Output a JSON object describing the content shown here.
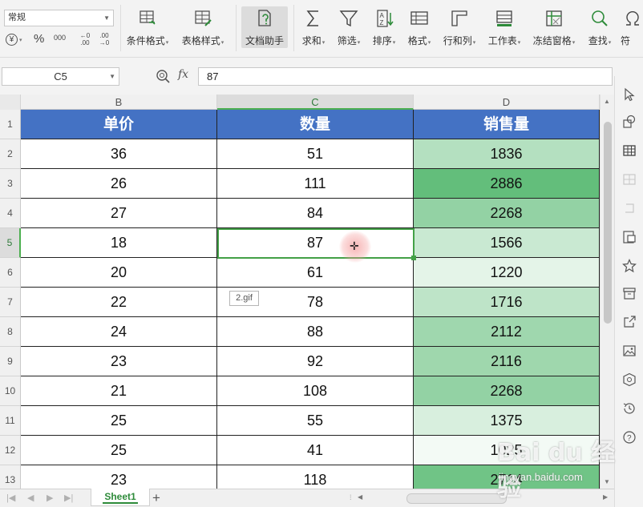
{
  "ribbon": {
    "number_format_select": "常规",
    "number_format_buttons": [
      "¥",
      "%",
      "000",
      "←0 .00",
      ".00 →0"
    ],
    "buttons": [
      {
        "id": "conditional-format",
        "label": "条件格式",
        "dropdown": true
      },
      {
        "id": "table-style",
        "label": "表格样式",
        "dropdown": true
      },
      {
        "id": "doc-assistant",
        "label": "文档助手",
        "dropdown": false,
        "active": true
      },
      {
        "id": "sum",
        "label": "求和",
        "dropdown": true
      },
      {
        "id": "filter",
        "label": "筛选",
        "dropdown": true
      },
      {
        "id": "sort",
        "label": "排序",
        "dropdown": true
      },
      {
        "id": "format",
        "label": "格式",
        "dropdown": true
      },
      {
        "id": "row-col",
        "label": "行和列",
        "dropdown": true
      },
      {
        "id": "worksheet",
        "label": "工作表",
        "dropdown": true
      },
      {
        "id": "freeze-panes",
        "label": "冻结窗格",
        "dropdown": true
      },
      {
        "id": "find",
        "label": "查找",
        "dropdown": true
      },
      {
        "id": "symbol",
        "label": "符",
        "dropdown": false
      }
    ]
  },
  "formula_bar": {
    "name_box": "C5",
    "fx_label": "fx",
    "formula_value": "87"
  },
  "grid": {
    "columns": [
      "B",
      "C",
      "D"
    ],
    "selected_column": "C",
    "row_numbers": [
      "1",
      "2",
      "3",
      "4",
      "5",
      "6",
      "7",
      "8",
      "9",
      "10",
      "11",
      "12",
      "13"
    ],
    "selected_row": "5",
    "header_row": [
      "单价",
      "数量",
      "销售量"
    ],
    "rows": [
      {
        "price": "36",
        "qty": "51",
        "sales": "1836"
      },
      {
        "price": "26",
        "qty": "111",
        "sales": "2886"
      },
      {
        "price": "27",
        "qty": "84",
        "sales": "2268"
      },
      {
        "price": "18",
        "qty": "87",
        "sales": "1566"
      },
      {
        "price": "20",
        "qty": "61",
        "sales": "1220"
      },
      {
        "price": "22",
        "qty": "78",
        "sales": "1716"
      },
      {
        "price": "24",
        "qty": "88",
        "sales": "2112"
      },
      {
        "price": "23",
        "qty": "92",
        "sales": "2116"
      },
      {
        "price": "21",
        "qty": "108",
        "sales": "2268"
      },
      {
        "price": "25",
        "qty": "55",
        "sales": "1375"
      },
      {
        "price": "25",
        "qty": "41",
        "sales": "1025"
      },
      {
        "price": "23",
        "qty": "118",
        "sales": "2714"
      }
    ],
    "sales_scale_colors": {
      "min": "#f3faf5",
      "max": "#63be7b"
    },
    "header_fill": "#4472c4",
    "active_cell": "C5",
    "image_label": "2.gif"
  },
  "bottom": {
    "sheet_tab": "Sheet1",
    "add_sheet_symbol": "+"
  },
  "watermark": {
    "logo": "Bai du 经验",
    "url": "jingyan.baidu.com"
  }
}
